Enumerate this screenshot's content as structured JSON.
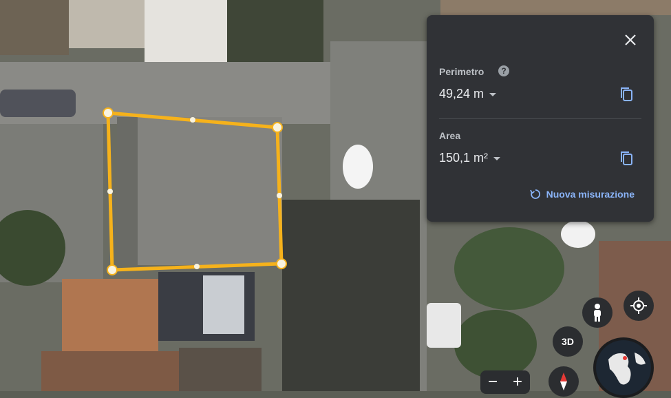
{
  "panel": {
    "perimeter_label": "Perimetro",
    "perimeter_help_icon": "help-icon",
    "perimeter_value": "49,24 m",
    "area_label": "Area",
    "area_value": "150,1 m²",
    "new_measurement_label": "Nuova misurazione",
    "close_icon": "close-icon",
    "copy_icon": "copy-icon",
    "refresh_icon": "refresh-icon"
  },
  "controls": {
    "view_3d_label": "3D",
    "zoom_out_label": "−",
    "zoom_in_label": "+",
    "pegman_icon": "pegman-icon",
    "location_icon": "my-location-icon",
    "compass_icon": "compass-icon",
    "globe_icon": "globe-icon"
  },
  "colors": {
    "measure_line": "#f6b21b",
    "panel_bg": "#303236",
    "accent": "#8ab4f8"
  }
}
